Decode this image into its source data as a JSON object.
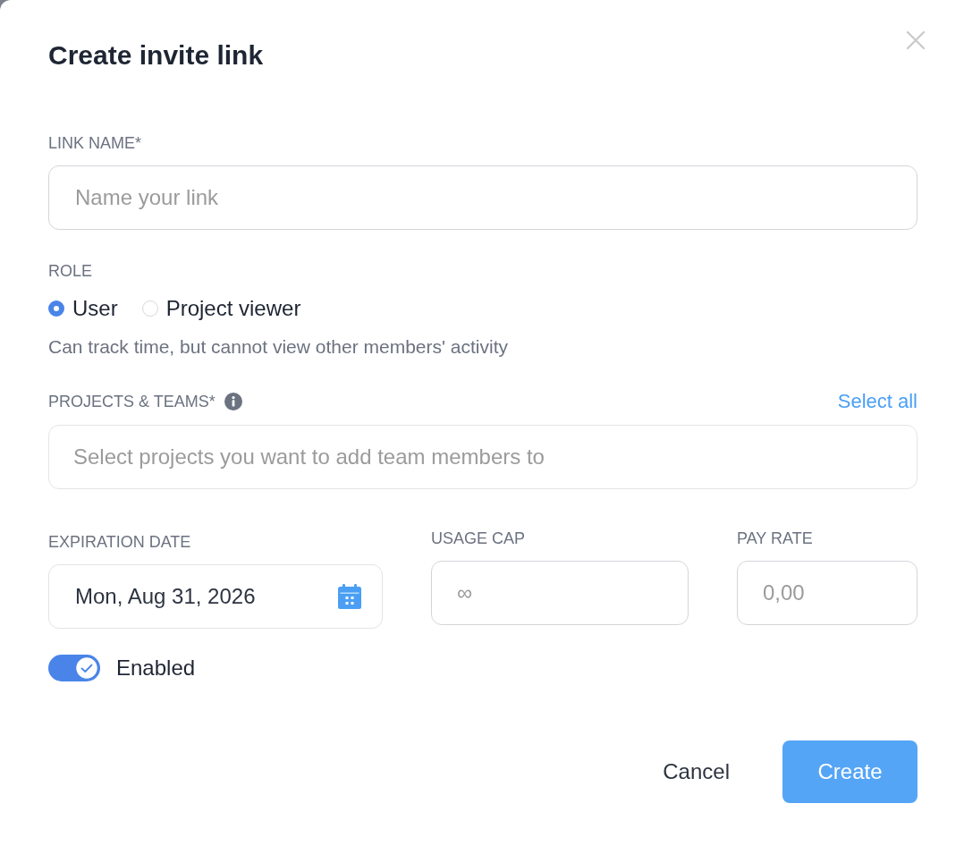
{
  "dialog": {
    "title": "Create invite link"
  },
  "link_name": {
    "label": "LINK NAME*",
    "placeholder": "Name your link"
  },
  "role": {
    "label": "ROLE",
    "options": [
      {
        "label": "User",
        "selected": true
      },
      {
        "label": "Project viewer",
        "selected": false
      }
    ],
    "description": "Can track time, but cannot view other members' activity"
  },
  "projects_teams": {
    "label": "PROJECTS & TEAMS*",
    "select_all": "Select all",
    "placeholder": "Select projects you want to add team members to"
  },
  "expiration_date": {
    "label": "EXPIRATION DATE",
    "value": "Mon, Aug 31, 2026"
  },
  "usage_cap": {
    "label": "USAGE CAP",
    "placeholder": "∞"
  },
  "pay_rate": {
    "label": "PAY RATE",
    "placeholder": "0,00"
  },
  "enabled": {
    "label": "Enabled",
    "on": true
  },
  "buttons": [
    {
      "label": "Cancel",
      "kind": "secondary"
    },
    {
      "label": "Create",
      "kind": "primary"
    }
  ]
}
